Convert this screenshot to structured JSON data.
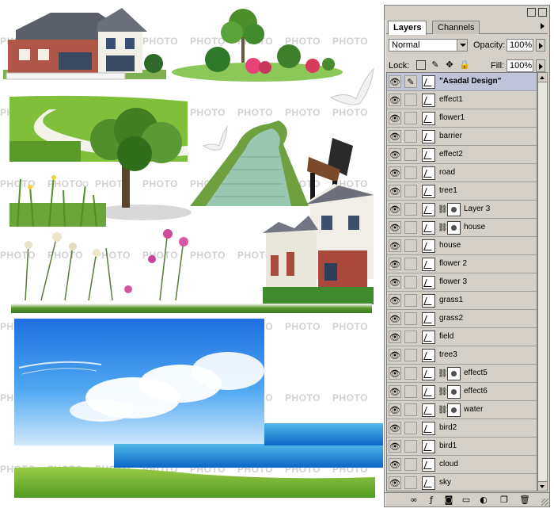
{
  "canvas": {
    "watermark_text": "PHOTO"
  },
  "panel": {
    "tabs": [
      {
        "label": "Layers",
        "active": true
      },
      {
        "label": "Channels",
        "active": false
      }
    ],
    "blend_mode": "Normal",
    "opacity_label": "Opacity:",
    "opacity_value": "100%",
    "lock_label": "Lock:",
    "fill_label": "Fill:",
    "fill_value": "100%",
    "layers": [
      {
        "name": "\"Asadal Design\"",
        "bold": true,
        "selected": true,
        "has_mask": false,
        "brush": true
      },
      {
        "name": "effect1",
        "has_mask": false
      },
      {
        "name": "flower1",
        "has_mask": false
      },
      {
        "name": "barrier",
        "has_mask": false
      },
      {
        "name": "effect2",
        "has_mask": false
      },
      {
        "name": "road",
        "has_mask": false
      },
      {
        "name": "tree1",
        "has_mask": false
      },
      {
        "name": "Layer 3",
        "has_mask": true
      },
      {
        "name": "house",
        "has_mask": true
      },
      {
        "name": "house",
        "has_mask": false
      },
      {
        "name": "flower 2",
        "has_mask": false
      },
      {
        "name": "flower 3",
        "has_mask": false
      },
      {
        "name": "grass1",
        "has_mask": false
      },
      {
        "name": "grass2",
        "has_mask": false
      },
      {
        "name": "field",
        "has_mask": false
      },
      {
        "name": "tree3",
        "has_mask": false
      },
      {
        "name": "effect5",
        "has_mask": true
      },
      {
        "name": "effect6",
        "has_mask": true
      },
      {
        "name": "water",
        "has_mask": true
      },
      {
        "name": "bird2",
        "has_mask": false
      },
      {
        "name": "bird1",
        "has_mask": false
      },
      {
        "name": "cloud",
        "has_mask": false
      },
      {
        "name": "sky",
        "has_mask": false
      }
    ],
    "icons": {
      "eye": "eye-icon",
      "lock_transparent": "lock-transparent-icon",
      "lock_image": "brush-icon",
      "lock_position": "move-icon",
      "lock_all": "padlock-icon"
    },
    "colors": {
      "panel_bg": "#d4d0c8",
      "selected_row": "#c0c4d8"
    }
  }
}
